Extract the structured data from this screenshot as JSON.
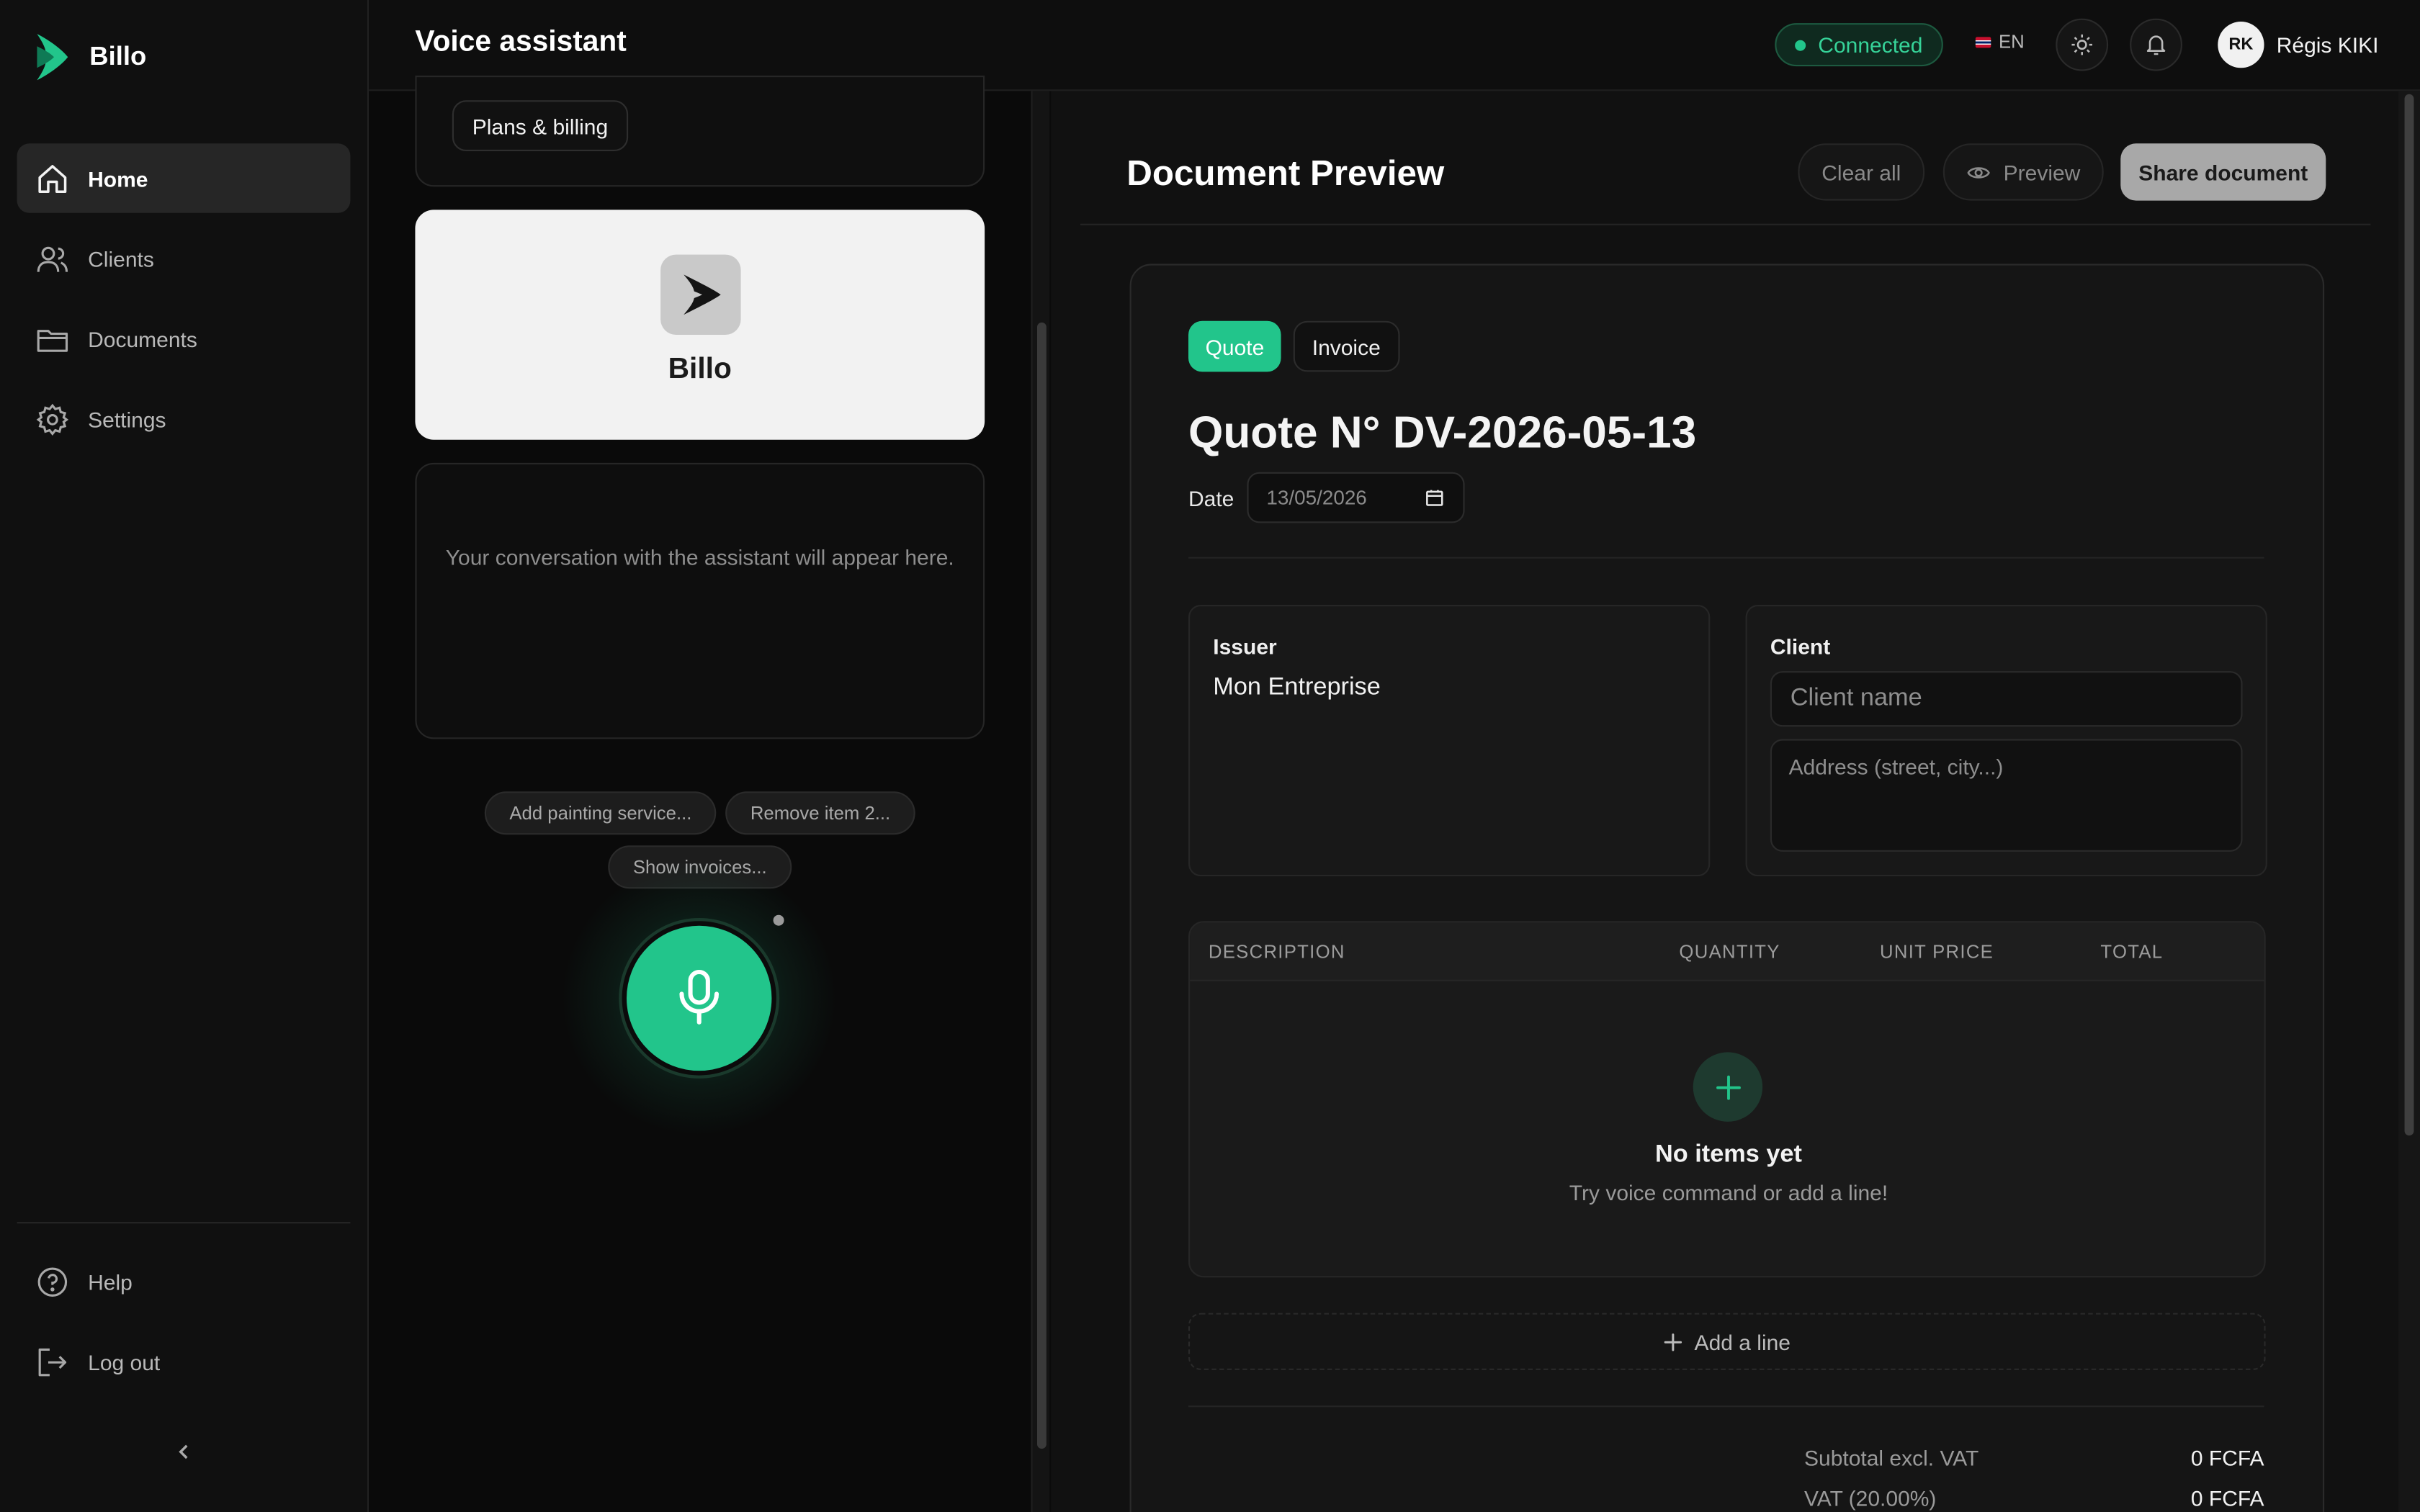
{
  "brand": {
    "name": "Billo",
    "accent": "#22c58b"
  },
  "sidebar": {
    "items": [
      {
        "label": "Home",
        "icon": "home-icon",
        "active": true
      },
      {
        "label": "Clients",
        "icon": "users-icon"
      },
      {
        "label": "Documents",
        "icon": "folder-icon"
      },
      {
        "label": "Settings",
        "icon": "gear-icon"
      }
    ],
    "bottom": [
      {
        "label": "Help",
        "icon": "help-icon"
      },
      {
        "label": "Log out",
        "icon": "logout-icon"
      }
    ]
  },
  "header": {
    "title": "Voice assistant",
    "status": "Connected",
    "language": "EN",
    "user": {
      "initials": "RK",
      "name": "Régis KIKI"
    }
  },
  "assistant": {
    "plans_chip": "Plans & billing",
    "logo_name": "Billo",
    "conversation_placeholder": "Your conversation with the assistant will appear here.",
    "suggestions": [
      "Add painting service...",
      "Remove item 2...",
      "Show invoices..."
    ]
  },
  "preview": {
    "title": "Document Preview",
    "clear_label": "Clear all",
    "preview_label": "Preview",
    "share_label": "Share document",
    "types": [
      "Quote",
      "Invoice"
    ],
    "selected_type": "Quote",
    "doc_title": "Quote N° DV-2026-05-13",
    "date_label": "Date",
    "date_value": "13/05/2026",
    "issuer_label": "Issuer",
    "issuer_name": "Mon Entreprise",
    "client_label": "Client",
    "client_name_placeholder": "Client name",
    "client_address_placeholder": "Address (street, city...)",
    "columns": [
      "DESCRIPTION",
      "QUANTITY",
      "UNIT PRICE",
      "TOTAL"
    ],
    "empty_title": "No items yet",
    "empty_subtitle": "Try voice command or add a line!",
    "add_line_label": "Add a line",
    "subtotal_label": "Subtotal excl. VAT",
    "subtotal_value": "0 FCFA",
    "vat_label": "VAT (20.00%)",
    "vat_value": "0 FCFA"
  }
}
